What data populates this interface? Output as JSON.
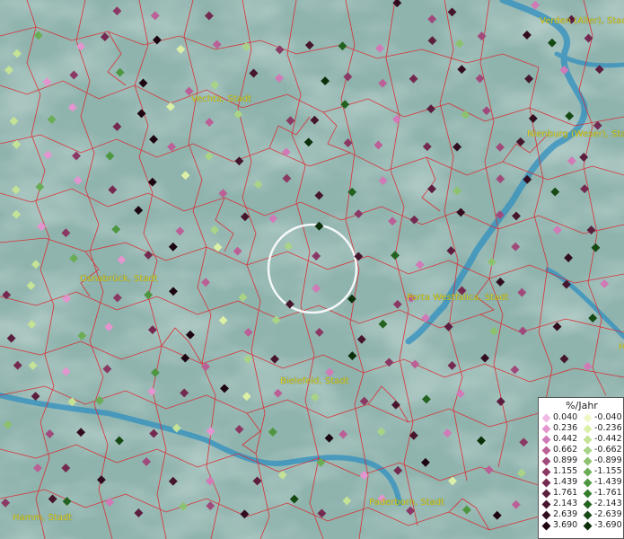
{
  "cities": [
    {
      "name": "Verden (Aller), Stadt"
    },
    {
      "name": "Vechta, Stadt"
    },
    {
      "name": "Nienburg (Weser), Stadt"
    },
    {
      "name": "Osnabrück, Stadt"
    },
    {
      "name": "Porta Westfalica, Stadt"
    },
    {
      "name": "Bielefeld, Stadt"
    },
    {
      "name": "Paderborn, Stadt"
    },
    {
      "name": "Hamm, Stadt"
    },
    {
      "name": "H"
    }
  ],
  "legend": {
    "title": "%/Jahr",
    "rows": [
      {
        "pos": "0.040",
        "neg": "-0.040",
        "pos_color": "#f2b8e4",
        "neg_color": "#f0f7c4"
      },
      {
        "pos": "0.236",
        "neg": "-0.236",
        "pos_color": "#e395cf",
        "neg_color": "#dcefa6"
      },
      {
        "pos": "0.442",
        "neg": "-0.442",
        "pos_color": "#d07ab7",
        "neg_color": "#c4e396"
      },
      {
        "pos": "0.662",
        "neg": "-0.662",
        "pos_color": "#ba6096",
        "neg_color": "#a9d488"
      },
      {
        "pos": "0.899",
        "neg": "-0.899",
        "pos_color": "#a04a7c",
        "neg_color": "#8cc26f"
      },
      {
        "pos": "1.155",
        "neg": "-1.155",
        "pos_color": "#8a3864",
        "neg_color": "#6aad55"
      },
      {
        "pos": "1.439",
        "neg": "-1.439",
        "pos_color": "#742a50",
        "neg_color": "#4e963f"
      },
      {
        "pos": "1.761",
        "neg": "-1.761",
        "pos_color": "#5c1e3e",
        "neg_color": "#357d2d"
      },
      {
        "pos": "2.143",
        "neg": "-2.143",
        "pos_color": "#46152e",
        "neg_color": "#23631f"
      },
      {
        "pos": "2.639",
        "neg": "-2.639",
        "pos_color": "#320d20",
        "neg_color": "#164a14"
      },
      {
        "pos": "3.690",
        "neg": "-3.690",
        "pos_color": "#1e0512",
        "neg_color": "#0b300a"
      }
    ]
  },
  "colors": {
    "background": "#8fb3ad",
    "boundary": "#e0222a",
    "river": "#2f8fc0",
    "label": "#e4d61a",
    "selection_circle": "#ffffff"
  },
  "markers": [
    {
      "cls": "p5"
    },
    {
      "cls": "p3"
    },
    {
      "cls": "p6"
    },
    {
      "cls": "p9"
    },
    {
      "cls": "p4"
    },
    {
      "cls": "p8"
    },
    {
      "cls": "p2"
    },
    {
      "cls": "p7"
    },
    {
      "cls": "n2"
    },
    {
      "cls": "n5"
    },
    {
      "cls": "p1"
    },
    {
      "cls": "p6"
    },
    {
      "cls": "p10"
    },
    {
      "cls": "n1"
    },
    {
      "cls": "p3"
    },
    {
      "cls": "n3"
    },
    {
      "cls": "p5"
    },
    {
      "cls": "p8"
    },
    {
      "cls": "n8"
    },
    {
      "cls": "p2"
    },
    {
      "cls": "p7"
    },
    {
      "cls": "n4"
    },
    {
      "cls": "p4"
    },
    {
      "cls": "p9"
    },
    {
      "cls": "n9"
    },
    {
      "cls": "p6"
    },
    {
      "cls": "n2"
    },
    {
      "cls": "p1"
    },
    {
      "cls": "p5"
    },
    {
      "cls": "n6"
    },
    {
      "cls": "p10"
    },
    {
      "cls": "p3"
    },
    {
      "cls": "n3"
    },
    {
      "cls": "p8"
    },
    {
      "cls": "p2"
    },
    {
      "cls": "n10"
    }
  ]
}
